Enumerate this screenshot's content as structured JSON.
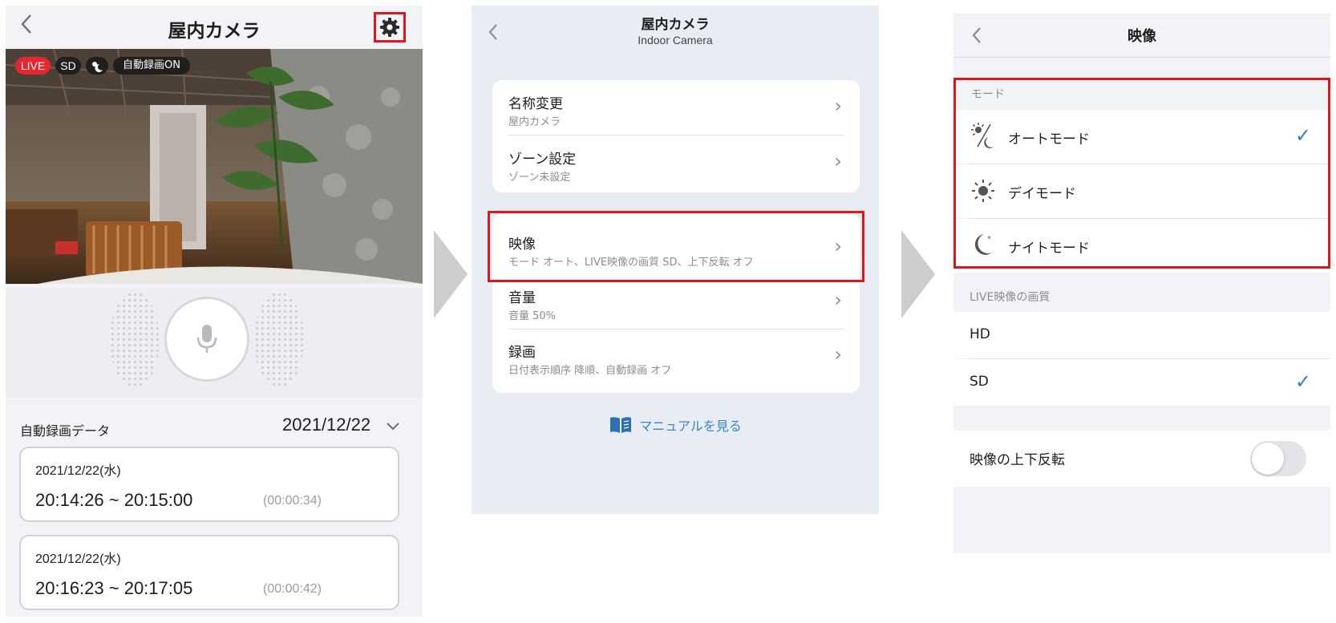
{
  "screen1": {
    "title": "屋内カメラ",
    "back_icon": "chevron-left-icon",
    "settings_icon": "gear-icon",
    "badges": {
      "live": "LIVE",
      "quality": "SD",
      "mode_icon": "auto-mode-icon",
      "auto_rec": "自動録画ON"
    },
    "mic_icon": "microphone-icon",
    "recording_label": "自動録画データ",
    "recording_date": "2021/12/22",
    "records": [
      {
        "date": "2021/12/22(水)",
        "time": "20:14:26 ~ 20:15:00",
        "duration": "(00:00:34)"
      },
      {
        "date": "2021/12/22(水)",
        "time": "20:16:23 ~ 20:17:05",
        "duration": "(00:00:42)"
      }
    ],
    "colors": {
      "live": "#e8262d",
      "highlight": "#e0161d"
    }
  },
  "screen2": {
    "title": "屋内カメラ",
    "subtitle": "Indoor Camera",
    "group1": [
      {
        "label": "名称変更",
        "sub": "屋内カメラ"
      },
      {
        "label": "ゾーン設定",
        "sub": "ゾーン未設定"
      }
    ],
    "group2": [
      {
        "label": "映像",
        "sub": "モード オート、LIVE映像の画質 SD、上下反転 オフ"
      },
      {
        "label": "音量",
        "sub": "音量 50%"
      },
      {
        "label": "録画",
        "sub": "日付表示順序 降順、自動録画 オフ"
      }
    ],
    "chevron": "›",
    "manual_label": "マニュアルを見る",
    "manual_icon": "book-icon",
    "colors": {
      "link": "#3a86c8"
    }
  },
  "screen3": {
    "title": "映像",
    "mode_section": "モード",
    "modes": [
      {
        "label": "オートモード",
        "icon": "auto-mode-icon",
        "selected": true
      },
      {
        "label": "デイモード",
        "icon": "sun-icon",
        "selected": false
      },
      {
        "label": "ナイトモード",
        "icon": "moon-icon",
        "selected": false
      }
    ],
    "quality_section": "LIVE映像の画質",
    "qualities": [
      {
        "label": "HD",
        "selected": false
      },
      {
        "label": "SD",
        "selected": true
      }
    ],
    "flip_label": "映像の上下反転",
    "flip_on": false,
    "check_mark": "✓",
    "colors": {
      "check": "#2f7fd0"
    }
  }
}
